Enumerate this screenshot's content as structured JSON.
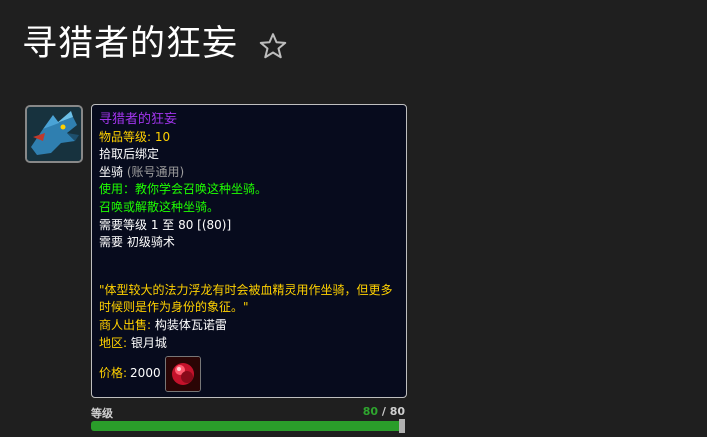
{
  "page": {
    "title": "寻猎者的狂妄",
    "star_icon": "star-outline-icon"
  },
  "item": {
    "icon": "blue-dragonhawk-mount-icon",
    "name": "寻猎者的狂妄",
    "item_level_label": "物品等级:",
    "item_level_value": "10",
    "bind": "拾取后绑定",
    "type": "坐骑",
    "type_note": "(账号通用)",
    "use_text": "使用：教你学会召唤这种坐骑。",
    "summon_text": "召唤或解散这种坐骑。",
    "req_level": "需要等级 1 至 80 [(80)]",
    "req_skill_prefix": "需要",
    "req_skill": "初级骑术",
    "flavor": "\"体型较大的法力浮龙有时会被血精灵用作坐骑，但更多时候则是作为身份的象征。\"",
    "vendor_label": "商人出售:",
    "vendor": "构装体瓦诺雷",
    "zone_label": "地区:",
    "zone": "银月城",
    "price_label": "价格:",
    "price": "2000",
    "price_icon": "red-gem-currency-icon"
  },
  "level_slider": {
    "label": "等级",
    "current": "80",
    "separator": " / ",
    "max": "80",
    "fill_fraction": 1.0
  },
  "colors": {
    "item_name": "#a335ee",
    "gold": "#ffd100",
    "green": "#1eff00",
    "slider_fill": "#2a9d2a"
  }
}
